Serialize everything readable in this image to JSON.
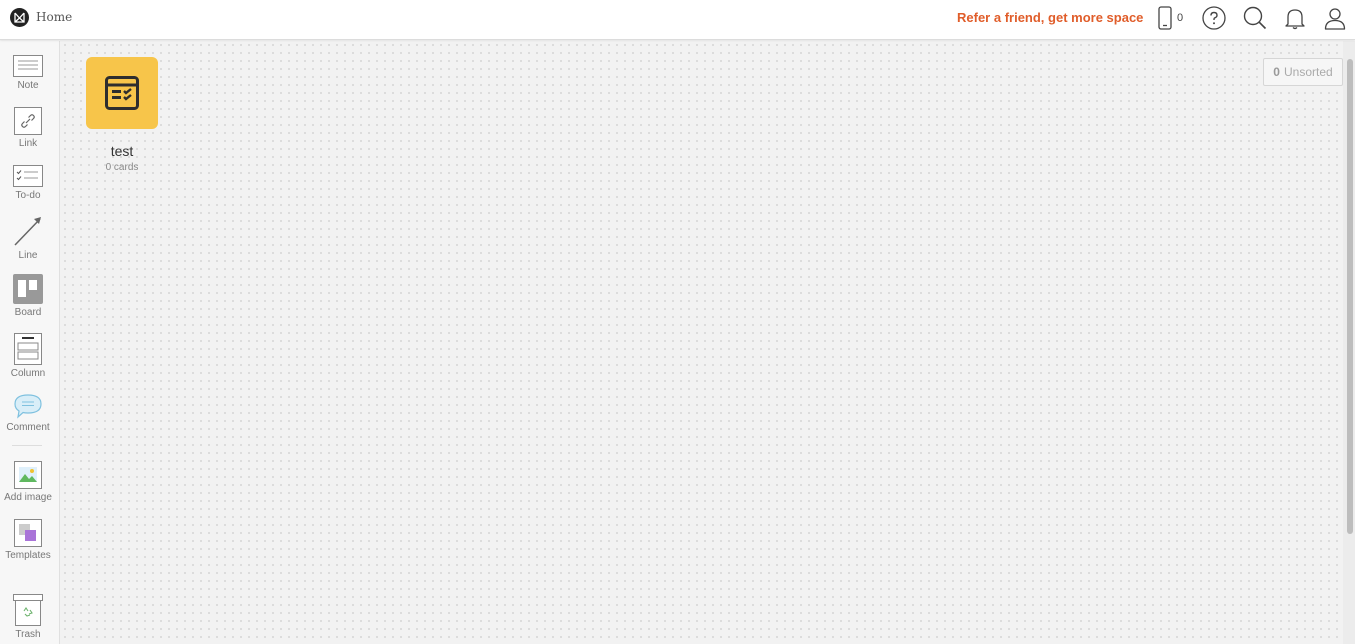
{
  "header": {
    "breadcrumb": "Home",
    "refer_link": "Refer a friend, get more space",
    "device_count": "0",
    "icons": [
      "logo-icon",
      "phone-icon",
      "help-icon",
      "search-icon",
      "bell-icon",
      "user-icon"
    ]
  },
  "sidebar": {
    "items": [
      {
        "label": "Note",
        "icon": "note-icon"
      },
      {
        "label": "Link",
        "icon": "link-icon"
      },
      {
        "label": "To-do",
        "icon": "todo-icon"
      },
      {
        "label": "Line",
        "icon": "line-icon"
      },
      {
        "label": "Board",
        "icon": "board-icon"
      },
      {
        "label": "Column",
        "icon": "column-icon"
      },
      {
        "label": "Comment",
        "icon": "comment-icon"
      },
      {
        "label": "Add image",
        "icon": "image-icon"
      },
      {
        "label": "Templates",
        "icon": "templates-icon"
      },
      {
        "label": "Trash",
        "icon": "trash-icon"
      }
    ]
  },
  "canvas": {
    "boards": [
      {
        "title": "test",
        "subtitle": "0 cards",
        "color": "#f7c54a"
      }
    ],
    "unsorted": {
      "count": "0",
      "label": "Unsorted"
    }
  },
  "colors": {
    "accent": "#e05d2a",
    "board_tile": "#f7c54a",
    "canvas_bg": "#f2f2f2"
  }
}
